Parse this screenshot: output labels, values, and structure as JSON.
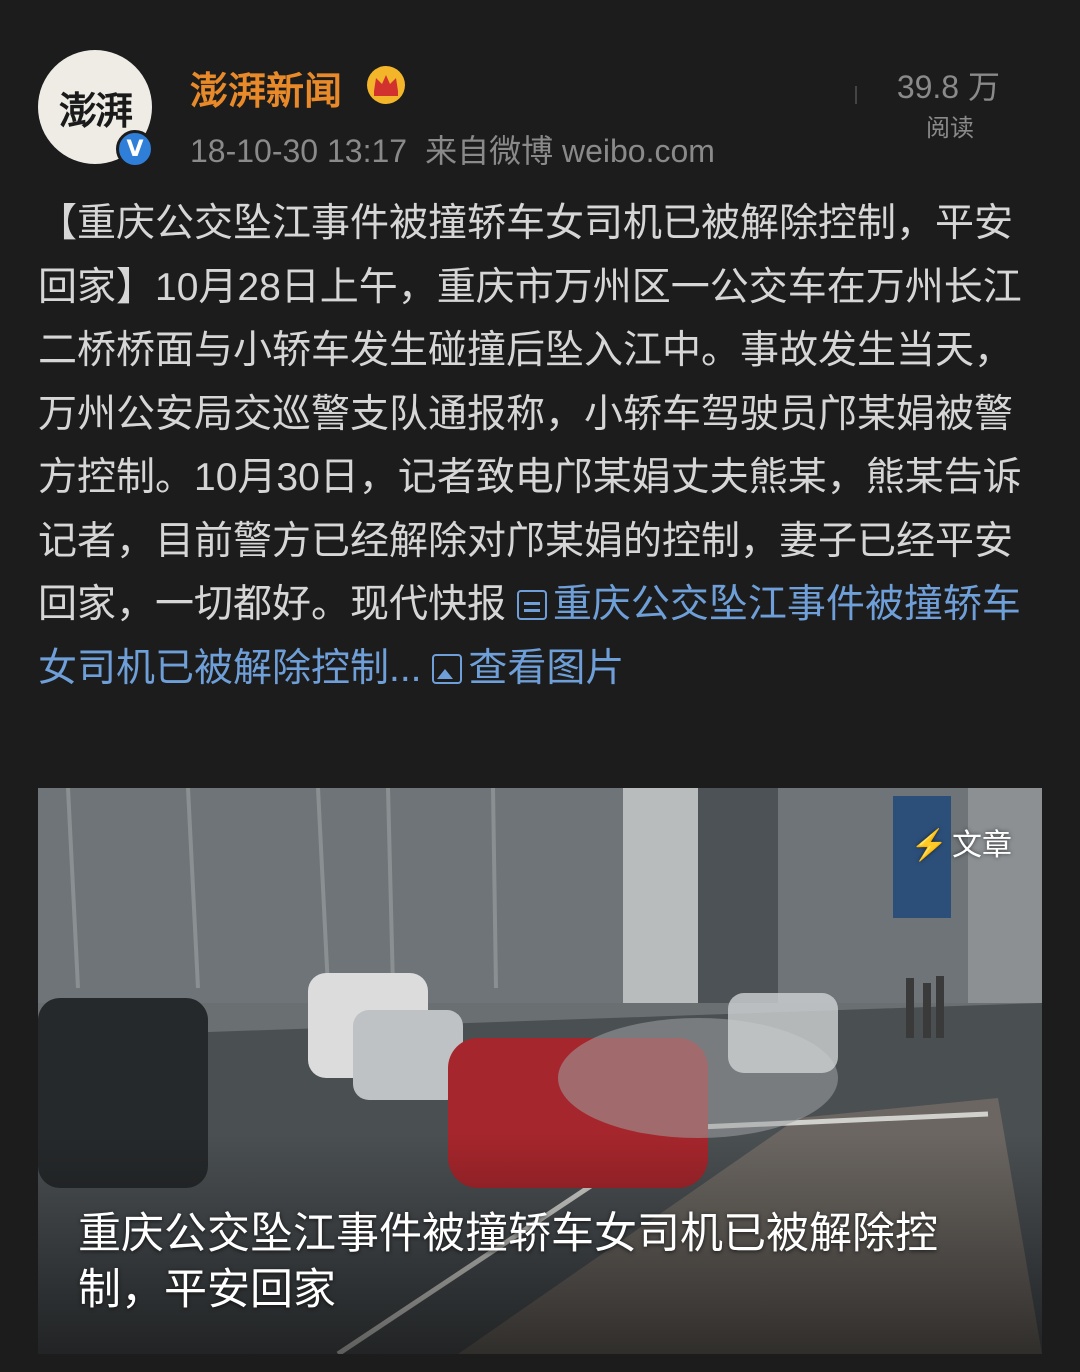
{
  "account": {
    "avatar_text": "澎湃",
    "name": "澎湃新闻",
    "verified_mark": "V",
    "badge_icon": "crown-icon",
    "timestamp": "18-10-30 13:17",
    "source": "来自微博 weibo.com"
  },
  "stats": {
    "reads_count": "39.8 万",
    "reads_label": "阅读"
  },
  "post": {
    "text": "【重庆公交坠江事件被撞轿车女司机已被解除控制，平安回家】10月28日上午，重庆市万州区一公交车在万州长江二桥桥面与小轿车发生碰撞后坠入江中。事故发生当天，万州公安局交巡警支队通报称，小轿车驾驶员邝某娟被警方控制。10月30日，记者致电邝某娟丈夫熊某，熊某告诉记者，目前警方已经解除对邝某娟的控制，妻子已经平安回家，一切都好。现代快报 ",
    "article_link": "重庆公交坠江事件被撞轿车女司机已被解除控制...",
    "image_link": "查看图片",
    "link_color": "#6f9fd8"
  },
  "media": {
    "badge_icon": "⚡",
    "badge_label": "文章",
    "caption": "重庆公交坠江事件被撞轿车女司机已被解除控制，平安回家"
  },
  "colors": {
    "background": "#1c1c1c",
    "username": "#e8892a",
    "verified": "#2f7ed8"
  }
}
